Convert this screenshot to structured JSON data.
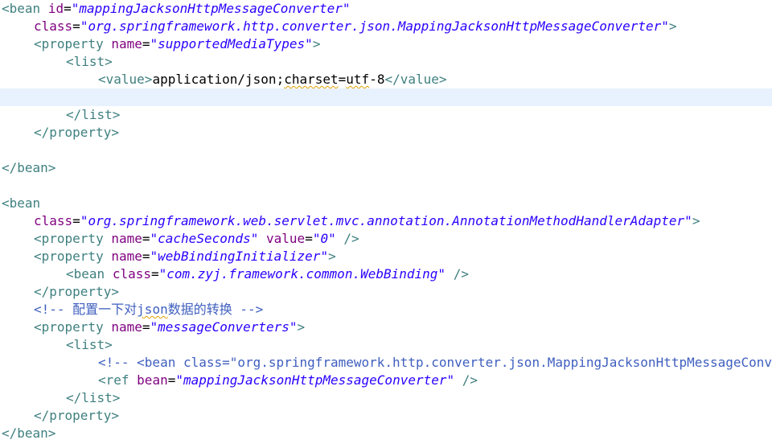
{
  "editor": {
    "colors": {
      "tag": "#3f7f7f",
      "attribute": "#7f007f",
      "value": "#2a00ff",
      "text": "#000000",
      "comment": "#3f5fbf",
      "current_line": "#e8f2fe"
    },
    "lines": [
      {
        "indent": 0,
        "tokens": [
          [
            "tag",
            "<bean"
          ],
          [
            "sp",
            " "
          ],
          [
            "attr",
            "id"
          ],
          [
            "eq",
            "="
          ],
          [
            "val",
            "\"mappingJacksonHttpMessageConverter\""
          ]
        ]
      },
      {
        "indent": 1,
        "tokens": [
          [
            "attr",
            "class"
          ],
          [
            "eq",
            "="
          ],
          [
            "val",
            "\"org.springframework.http.converter.json.MappingJacksonHttpMessageConverter\""
          ],
          [
            "tag",
            ">"
          ]
        ]
      },
      {
        "indent": 1,
        "tokens": [
          [
            "tag",
            "<property"
          ],
          [
            "sp",
            " "
          ],
          [
            "attr",
            "name"
          ],
          [
            "eq",
            "="
          ],
          [
            "val",
            "\"supportedMediaTypes\""
          ],
          [
            "tag",
            ">"
          ]
        ]
      },
      {
        "indent": 2,
        "tokens": [
          [
            "tag",
            "<list>"
          ]
        ]
      },
      {
        "indent": 3,
        "tokens": [
          [
            "tag",
            "<value>"
          ],
          [
            "txt",
            "application/json;"
          ],
          [
            "sq",
            "charset"
          ],
          [
            "txt",
            "="
          ],
          [
            "sq",
            "utf"
          ],
          [
            "txt",
            "-8"
          ],
          [
            "tag",
            "</value>"
          ]
        ]
      },
      {
        "indent": 0,
        "current": true,
        "tokens": []
      },
      {
        "indent": 2,
        "tokens": [
          [
            "tag",
            "</list>"
          ]
        ]
      },
      {
        "indent": 1,
        "tokens": [
          [
            "tag",
            "</property>"
          ]
        ]
      },
      {
        "indent": 0,
        "tokens": []
      },
      {
        "indent": 0,
        "tokens": [
          [
            "tag",
            "</bean>"
          ]
        ]
      },
      {
        "indent": 0,
        "tokens": []
      },
      {
        "indent": 0,
        "tokens": [
          [
            "tag",
            "<bean"
          ]
        ]
      },
      {
        "indent": 1,
        "tokens": [
          [
            "attr",
            "class"
          ],
          [
            "eq",
            "="
          ],
          [
            "val",
            "\"org.springframework.web.servlet.mvc.annotation.AnnotationMethodHandlerAdapter\""
          ],
          [
            "tag",
            ">"
          ]
        ]
      },
      {
        "indent": 1,
        "tokens": [
          [
            "tag",
            "<property"
          ],
          [
            "sp",
            " "
          ],
          [
            "attr",
            "name"
          ],
          [
            "eq",
            "="
          ],
          [
            "val",
            "\"cacheSeconds\""
          ],
          [
            "sp",
            " "
          ],
          [
            "attr",
            "value"
          ],
          [
            "eq",
            "="
          ],
          [
            "val",
            "\"0\""
          ],
          [
            "sp",
            " "
          ],
          [
            "tag",
            "/>"
          ]
        ]
      },
      {
        "indent": 1,
        "tokens": [
          [
            "tag",
            "<property"
          ],
          [
            "sp",
            " "
          ],
          [
            "attr",
            "name"
          ],
          [
            "eq",
            "="
          ],
          [
            "val",
            "\"webBindingInitializer\""
          ],
          [
            "tag",
            ">"
          ]
        ]
      },
      {
        "indent": 2,
        "tokens": [
          [
            "tag",
            "<bean"
          ],
          [
            "sp",
            " "
          ],
          [
            "attr",
            "class"
          ],
          [
            "eq",
            "="
          ],
          [
            "val",
            "\"com.zyj.framework.common.WebBinding\""
          ],
          [
            "sp",
            " "
          ],
          [
            "tag",
            "/>"
          ]
        ]
      },
      {
        "indent": 1,
        "tokens": [
          [
            "tag",
            "</property>"
          ]
        ]
      },
      {
        "indent": 1,
        "tokens": [
          [
            "cmt",
            "<!-- 配置一下对"
          ],
          [
            "cmtsq",
            "json"
          ],
          [
            "cmt",
            "数据的转换 -->"
          ]
        ]
      },
      {
        "indent": 1,
        "tokens": [
          [
            "tag",
            "<property"
          ],
          [
            "sp",
            " "
          ],
          [
            "attr",
            "name"
          ],
          [
            "eq",
            "="
          ],
          [
            "val",
            "\"messageConverters\""
          ],
          [
            "tag",
            ">"
          ]
        ]
      },
      {
        "indent": 2,
        "tokens": [
          [
            "tag",
            "<list>"
          ]
        ]
      },
      {
        "indent": 3,
        "tokens": [
          [
            "cmt",
            "<!-- <bean class=\"org.springframework.http.converter.json.MappingJacksonHttpMessageConverter\" /> -->"
          ]
        ]
      },
      {
        "indent": 3,
        "tokens": [
          [
            "tag",
            "<ref"
          ],
          [
            "sp",
            " "
          ],
          [
            "attr",
            "bean"
          ],
          [
            "eq",
            "="
          ],
          [
            "val",
            "\"mappingJacksonHttpMessageConverter\""
          ],
          [
            "sp",
            " "
          ],
          [
            "tag",
            "/>"
          ]
        ]
      },
      {
        "indent": 2,
        "tokens": [
          [
            "tag",
            "</list>"
          ]
        ]
      },
      {
        "indent": 1,
        "tokens": [
          [
            "tag",
            "</property>"
          ]
        ]
      },
      {
        "indent": 0,
        "tokens": [
          [
            "tag",
            "</bean>"
          ]
        ]
      }
    ]
  }
}
